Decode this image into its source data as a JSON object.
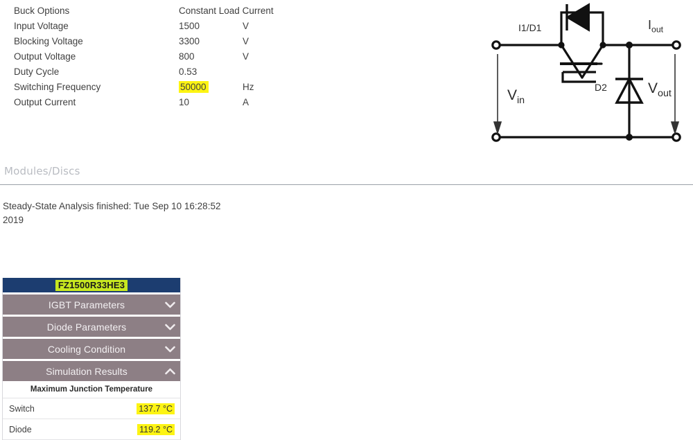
{
  "params": {
    "rows": [
      {
        "label": "Buck Options",
        "value": "Constant Load Current",
        "unit": "",
        "highlight": false
      },
      {
        "label": "Input Voltage",
        "value": "1500",
        "unit": "V",
        "highlight": false
      },
      {
        "label": "Blocking Voltage",
        "value": "3300",
        "unit": "V",
        "highlight": false
      },
      {
        "label": "Output Voltage",
        "value": "800",
        "unit": "V",
        "highlight": false
      },
      {
        "label": "Duty Cycle",
        "value": "0.53",
        "unit": "",
        "highlight": false
      },
      {
        "label": "Switching Frequency",
        "value": "50000",
        "unit": "Hz",
        "highlight": true
      },
      {
        "label": "Output Current",
        "value": "10",
        "unit": "A",
        "highlight": false
      }
    ]
  },
  "circuit": {
    "labels": {
      "switch": "I1/D1",
      "diode": "D2",
      "vin": "V",
      "vin_sub": "in",
      "vout": "V",
      "vout_sub": "out",
      "iout": "I",
      "iout_sub": "out"
    }
  },
  "section": {
    "heading": "Modules/Discs"
  },
  "status": {
    "message": "Steady-State Analysis finished: Tue Sep 10 16:28:52 2019"
  },
  "module_panel": {
    "title": "FZ1500R33HE3",
    "accordion": [
      {
        "label": "IGBT Parameters",
        "icon": "chevron-down-icon",
        "expanded": false
      },
      {
        "label": "Diode Parameters",
        "icon": "chevron-down-icon",
        "expanded": false
      },
      {
        "label": "Cooling Condition",
        "icon": "chevron-down-icon",
        "expanded": false
      },
      {
        "label": "Simulation Results",
        "icon": "chevron-up-icon",
        "expanded": true
      }
    ],
    "results": {
      "header": "Maximum Junction Temperature",
      "rows": [
        {
          "name": "Switch",
          "value": "137.7 °C",
          "highlight": true
        },
        {
          "name": "Diode",
          "value": "119.2 °C",
          "highlight": true
        }
      ]
    }
  },
  "colors": {
    "title_bar": "#1c3d70",
    "title_highlight": "#c8e820",
    "accordion": "#8d7f85",
    "value_highlight": "#fdf413",
    "heading_gray": "#b9bcc2"
  }
}
